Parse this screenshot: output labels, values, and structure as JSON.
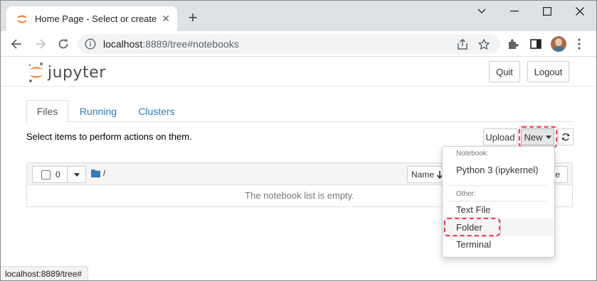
{
  "browser": {
    "tab_title": "Home Page - Select or create a notebook",
    "close_glyph": "✕",
    "newtab_glyph": "+",
    "url_host": "localhost",
    "url_rest": ":8889/tree#notebooks",
    "status_url": "localhost:8889/tree#"
  },
  "jupyter": {
    "logo_text": "jupyter",
    "quit_label": "Quit",
    "logout_label": "Logout",
    "tabs": [
      {
        "label": "Files",
        "active": true
      },
      {
        "label": "Running",
        "active": false
      },
      {
        "label": "Clusters",
        "active": false
      }
    ],
    "instructions": "Select items to perform actions on them.",
    "upload_label": "Upload",
    "new_label": "New",
    "select_count": "0",
    "breadcrumb_sep": "/",
    "sort_name_label": "Name",
    "sort_other_label": "e",
    "empty_message": "The notebook list is empty.",
    "dropdown": {
      "notebook_header": "Notebook:",
      "notebook_item": "Python 3 (ipykernel)",
      "other_header": "Other:",
      "other_items": [
        "Text File",
        "Folder",
        "Terminal"
      ]
    }
  },
  "colors": {
    "link": "#337ab7",
    "highlight": "#e8405a",
    "jupyter_orange": "#f37726"
  }
}
